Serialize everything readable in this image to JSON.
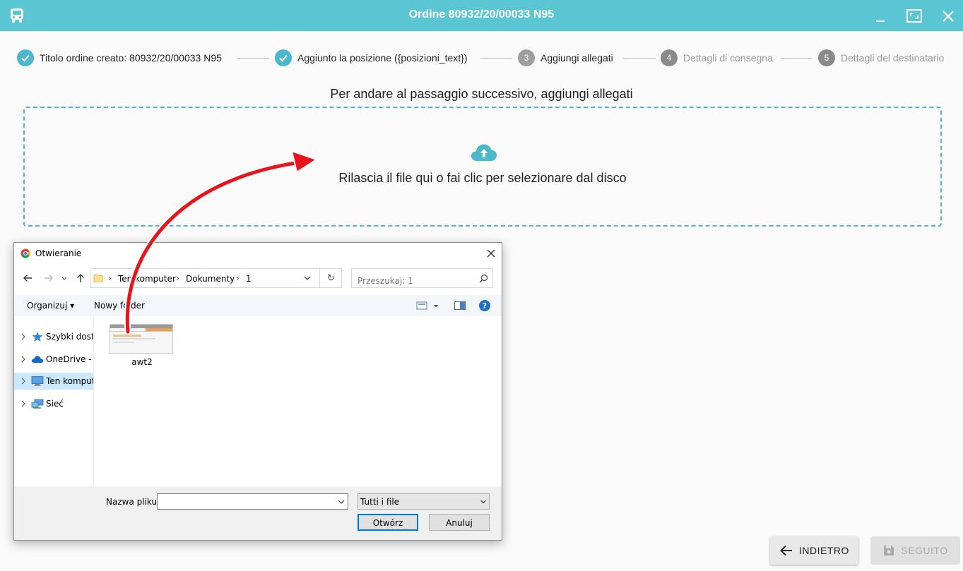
{
  "window": {
    "title": "Ordine 80932/20/00033 N95"
  },
  "stepper": {
    "steps": [
      {
        "num": "1",
        "label": "Titolo ordine creato: 80932/20/00033 N95",
        "state": "done"
      },
      {
        "num": "2",
        "label": "Aggiunto la posizione ({posizioni_text})",
        "state": "done"
      },
      {
        "num": "3",
        "label": "Aggiungi allegati",
        "state": "active"
      },
      {
        "num": "4",
        "label": "Dettagli di consegna",
        "state": "pending"
      },
      {
        "num": "5",
        "label": "Dettagli del destinatario",
        "state": "pending"
      }
    ]
  },
  "main": {
    "heading": "Per andare al passaggio successivo, aggiungi allegati",
    "dropzone_text": "Rilascia il file qui o fai clic per selezionare dal disco"
  },
  "buttons": {
    "back": "INDIETRO",
    "next": "SEGUITO"
  },
  "dialog": {
    "title": "Otwieranie",
    "path": [
      "Ten komputer",
      "Dokumenty",
      "1"
    ],
    "search_placeholder": "Przeszukaj: 1",
    "organize": "Organizuj",
    "new_folder": "Nowy folder",
    "nav": [
      {
        "label": "Szybki dostęp",
        "selected": false
      },
      {
        "label": "OneDrive - W",
        "selected": false
      },
      {
        "label": "Ten komputer",
        "selected": true
      },
      {
        "label": "Sieć",
        "selected": false
      }
    ],
    "files": [
      {
        "name": "awt2"
      }
    ],
    "filename_label": "Nazwa pliku:",
    "filename_value": "",
    "filetype": "Tutti i file",
    "open": "Otwórz",
    "cancel": "Anuluj"
  },
  "colors": {
    "accent": "#5bc6d3",
    "step_done": "#4bb8cc",
    "arrow": "#e8141b"
  }
}
